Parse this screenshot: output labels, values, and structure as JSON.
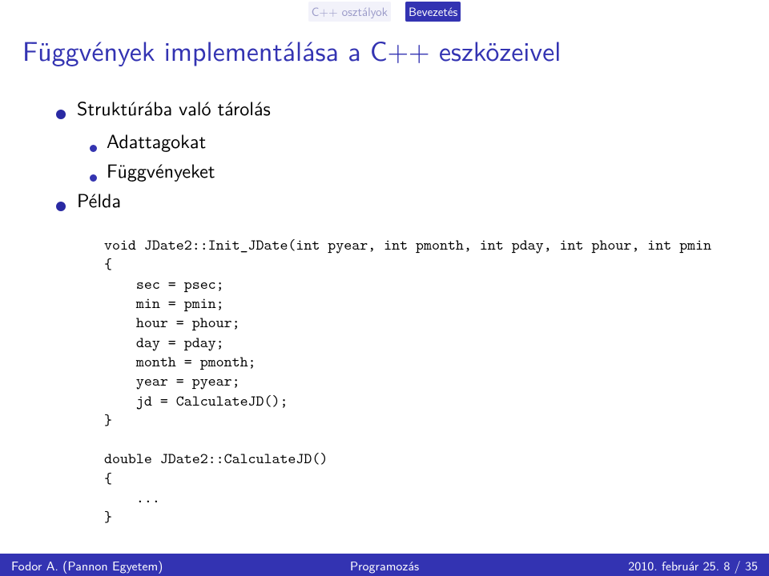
{
  "nav": {
    "left": "C++ osztályok",
    "right": "Bevezetés"
  },
  "title": "Függvények implementálása a C++ eszközeivel",
  "bullets": {
    "b1": "Struktúrába való tárolás",
    "b1a": "Adattagokat",
    "b1b": "Függvényeket",
    "b2": "Példa"
  },
  "code": "void JDate2::Init_JDate(int pyear, int pmonth, int pday, int phour, int pmin\n{\n    sec = psec;\n    min = pmin;\n    hour = phour;\n    day = pday;\n    month = pmonth;\n    year = pyear;\n    jd = CalculateJD();\n}\n\ndouble JDate2::CalculateJD()\n{\n    ...\n}",
  "footer": {
    "left": "Fodor A. (Pannon Egyetem)",
    "center": "Programozás",
    "right": "2010. február 25.    8 / 35"
  }
}
